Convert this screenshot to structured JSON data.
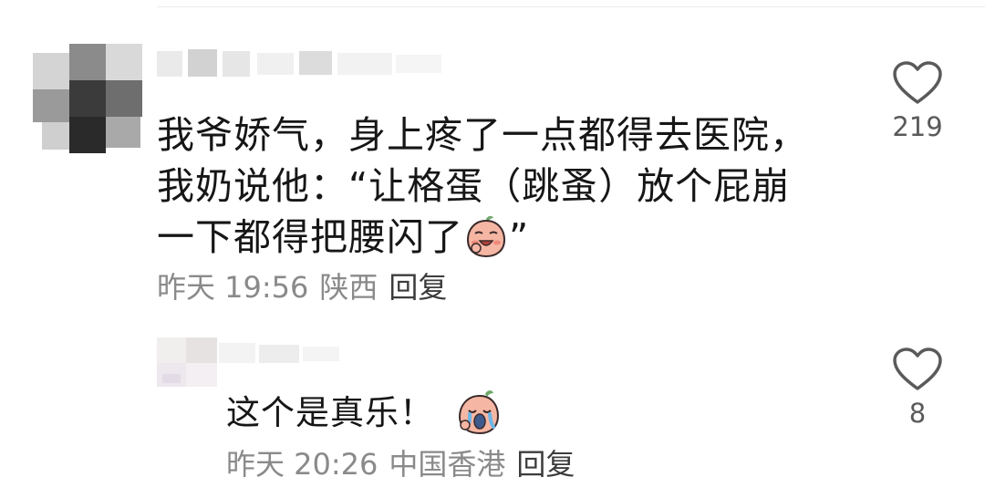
{
  "comment": {
    "text_lines": [
      "我爷娇气，身上疼了一点都得去医院，",
      "我奶说他：“让格蛋（跳蚤）放个屁崩",
      "一下都得把腰闪了"
    ],
    "text_tail": "”",
    "time": "昨天 19:56",
    "location": "陕西",
    "reply_label": "回复",
    "like_count": "219",
    "emoji": "laughing-peach-emoji"
  },
  "reply": {
    "text": "这个是真乐！",
    "time": "昨天 20:26",
    "location": "中国香港",
    "reply_label": "回复",
    "like_count": "8",
    "emoji": "crying-laughing-peach-emoji"
  },
  "colors": {
    "text": "#161616",
    "meta": "#8a8a8a",
    "heart_outline": "#5a5a5a",
    "peach": "#f5b3a2"
  }
}
